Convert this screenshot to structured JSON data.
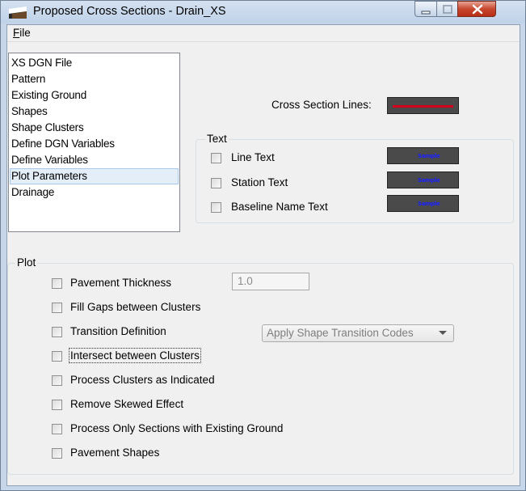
{
  "window": {
    "title": "Proposed Cross Sections - Drain_XS"
  },
  "menu": {
    "file_underlined": "F",
    "file_rest": "ile"
  },
  "nav": {
    "items": [
      {
        "label": "XS DGN File"
      },
      {
        "label": "Pattern"
      },
      {
        "label": "Existing Ground"
      },
      {
        "label": "Shapes"
      },
      {
        "label": "Shape Clusters"
      },
      {
        "label": "Define DGN Variables"
      },
      {
        "label": "Define Variables"
      },
      {
        "label": "Plot Parameters",
        "selected": true
      },
      {
        "label": "Drainage"
      }
    ]
  },
  "cross_section_lines": {
    "label": "Cross Section Lines:",
    "color": "#d2001d"
  },
  "text_group": {
    "legend": "Text",
    "items": [
      {
        "label": "Line Text",
        "checked": false,
        "sample": "Sample"
      },
      {
        "label": "Station Text",
        "checked": false,
        "sample": "Sample"
      },
      {
        "label": "Baseline Name Text",
        "checked": false,
        "sample": "Sample"
      }
    ]
  },
  "plot_group": {
    "legend": "Plot",
    "pavement_thickness": {
      "label": "Pavement Thickness",
      "checked": false,
      "value": "1.0"
    },
    "fill_gaps": {
      "label": "Fill Gaps between Clusters",
      "checked": false
    },
    "transition_definition": {
      "label": "Transition Definition",
      "checked": false,
      "selected": "Apply Shape Transition Codes"
    },
    "intersect": {
      "label": "Intersect between Clusters",
      "checked": false
    },
    "process_indicated": {
      "label": "Process Clusters as Indicated",
      "checked": false
    },
    "remove_skewed": {
      "label": "Remove Skewed Effect",
      "checked": false
    },
    "process_existing": {
      "label": "Process Only Sections with Existing Ground",
      "checked": false
    },
    "pavement_shapes": {
      "label": "Pavement Shapes",
      "checked": false
    }
  },
  "colors": {
    "title_bar": "#c7d6e8",
    "selection": "#e3eef9",
    "close_button": "#c7472f",
    "swatch_bg": "#4a4a4a",
    "sample_text": "#1a22ff"
  }
}
